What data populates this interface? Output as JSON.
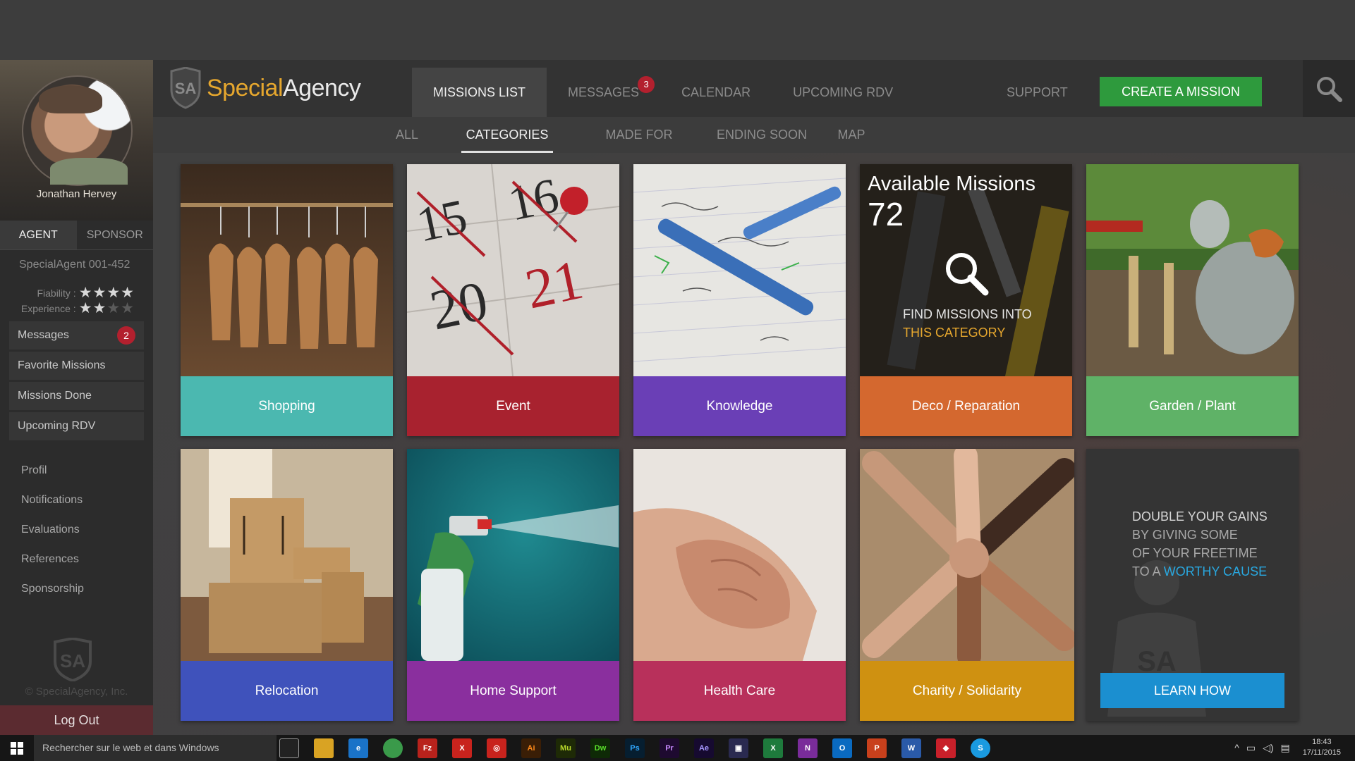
{
  "brand": {
    "part1": "Special",
    "part2": "Agency"
  },
  "nav": {
    "items": [
      "MISSIONS LIST",
      "MESSAGES",
      "CALENDAR",
      "UPCOMING RDV"
    ],
    "messages_badge": "3",
    "support": "SUPPORT",
    "create": "CREATE A MISSION"
  },
  "subnav": {
    "items": [
      "ALL",
      "CATEGORIES",
      "MADE FOR ME",
      "ENDING SOON",
      "MAP"
    ],
    "active": "CATEGORIES"
  },
  "profile": {
    "name": "Jonathan Hervey",
    "tabs": [
      "AGENT",
      "SPONSOR"
    ],
    "agent_id": "SpecialAgent 001-452",
    "fiability_label": "Fiability :",
    "fiability_stars": 4,
    "experience_label": "Experience :",
    "experience_stars": 2
  },
  "menu": {
    "items": [
      "Messages",
      "Favorite Missions",
      "Missions Done",
      "Upcoming RDV"
    ],
    "messages_badge": "2",
    "secondary": [
      "Profil",
      "Notifications",
      "Evaluations",
      "References",
      "Sponsorship"
    ]
  },
  "copyright": "© SpecialAgency, Inc.",
  "logout": "Log Out",
  "categories": [
    {
      "label": "Shopping",
      "color": "#4bb8b0"
    },
    {
      "label": "Event",
      "color": "#a8222f"
    },
    {
      "label": "Knowledge",
      "color": "#6a3fb6"
    },
    {
      "label": "Deco / Reparation",
      "color": "#d4682f"
    },
    {
      "label": "Garden / Plant",
      "color": "#5fb267"
    },
    {
      "label": "Relocation",
      "color": "#3f52bb"
    },
    {
      "label": "Home Support",
      "color": "#8a2f9e"
    },
    {
      "label": "Health Care",
      "color": "#b8305b"
    },
    {
      "label": "Charity / Solidarity",
      "color": "#cf9111"
    }
  ],
  "available": {
    "title": "Available Missions",
    "count": "72",
    "line1": "FIND MISSIONS INTO",
    "line2": "THIS CATEGORY"
  },
  "promo": {
    "line1": "DOUBLE YOUR GAINS",
    "line2": "BY GIVING SOME",
    "line3": "OF YOUR FREETIME",
    "line4_prefix": "TO A",
    "line4_highlight": "WORTHY CAUSE",
    "button": "LEARN HOW"
  },
  "taskbar": {
    "search": "Rechercher sur le web et dans Windows",
    "apps": [
      "Fz",
      "X",
      "◎",
      "Ai",
      "Mu",
      "Dw",
      "Ps",
      "Pr",
      "Ae",
      "▣",
      "X",
      "N",
      "O",
      "P",
      "W",
      "◆",
      "S"
    ],
    "time": "18:43",
    "date": "17/11/2015"
  },
  "colors": {
    "accent_green": "#2e9a3d",
    "accent_orange": "#e6a72e",
    "accent_blue": "#1b8fd0",
    "badge_red": "#b3202e"
  }
}
